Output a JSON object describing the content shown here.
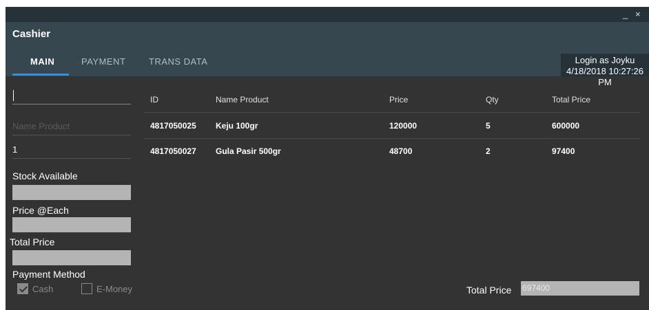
{
  "window": {
    "title": "Cashier",
    "minimize": "_",
    "close": "×"
  },
  "tabs": [
    {
      "label": "MAIN"
    },
    {
      "label": "PAYMENT"
    },
    {
      "label": "TRANS DATA"
    }
  ],
  "login": {
    "line1": "Login as Joyku",
    "line2": "4/18/2018 10:27:26 PM"
  },
  "form": {
    "search_value": "",
    "name_placeholder": "Name Product",
    "qty_value": "1",
    "stock_label": "Stock Available",
    "price_label": "Price @Each",
    "total_label": "Total Price",
    "method_label": "Payment Method",
    "cash_label": "Cash",
    "emoney_label": "E-Money"
  },
  "table": {
    "headers": [
      "ID",
      "Name Product",
      "Price",
      "Qty",
      "Total Price"
    ],
    "rows": [
      [
        "4817050025",
        "Keju 100gr",
        "120000",
        "5",
        "600000"
      ],
      [
        "4817050027",
        "Gula Pasir 500gr",
        "48700",
        "2",
        "97400"
      ]
    ]
  },
  "footer": {
    "total_label": "Total Price",
    "total_value": "697400"
  },
  "colors": {
    "accent": "#2196f3",
    "header": "#37474f",
    "titlebar": "#263238",
    "body": "#333333"
  }
}
